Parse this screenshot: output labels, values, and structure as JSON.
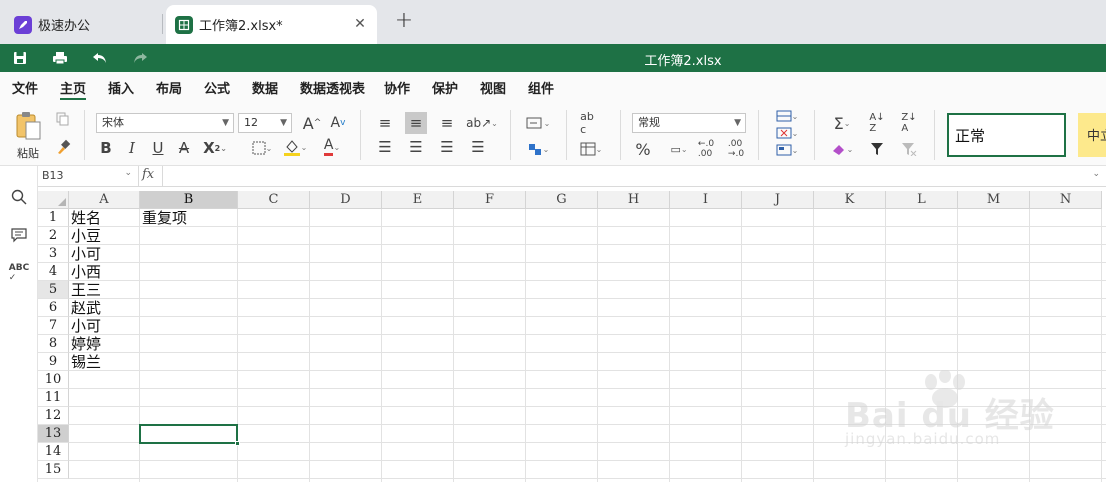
{
  "tabs": [
    {
      "label": "极速办公"
    },
    {
      "label": "工作簿2.xlsx*"
    }
  ],
  "titlebar": {
    "title": "工作簿2.xlsx"
  },
  "menu": [
    "文件",
    "主页",
    "插入",
    "布局",
    "公式",
    "数据",
    "数据透视表",
    "协作",
    "保护",
    "视图",
    "组件"
  ],
  "ribbon": {
    "paste_label": "粘贴",
    "font_name": "宋体",
    "font_size": "12",
    "number_format": "常规",
    "style_normal": "正常",
    "style_chinese": "中立"
  },
  "formula_bar": {
    "cell_ref": "B13",
    "fx": "fx",
    "value": ""
  },
  "columns": [
    "A",
    "B",
    "C",
    "D",
    "E",
    "F",
    "G",
    "H",
    "I",
    "J",
    "K",
    "L",
    "M",
    "N"
  ],
  "rows": [
    "1",
    "2",
    "3",
    "4",
    "5",
    "6",
    "7",
    "8",
    "9",
    "10",
    "11",
    "12",
    "13",
    "14",
    "15"
  ],
  "cells": {
    "A1": "姓名",
    "B1": "重复项",
    "A2": "小豆",
    "A3": "小可",
    "A4": "小西",
    "A5": "王三",
    "A6": "赵武",
    "A7": "小可",
    "A8": "婷婷",
    "A9": "锡兰"
  },
  "active_cell": "B13",
  "watermark": {
    "main": "Bai du 经验",
    "sub": "jingyan.baidu.com"
  },
  "colors": {
    "accent": "#1e7145",
    "tab_bg": "#e4e6ea",
    "app_icon": "#6b3fd6"
  }
}
